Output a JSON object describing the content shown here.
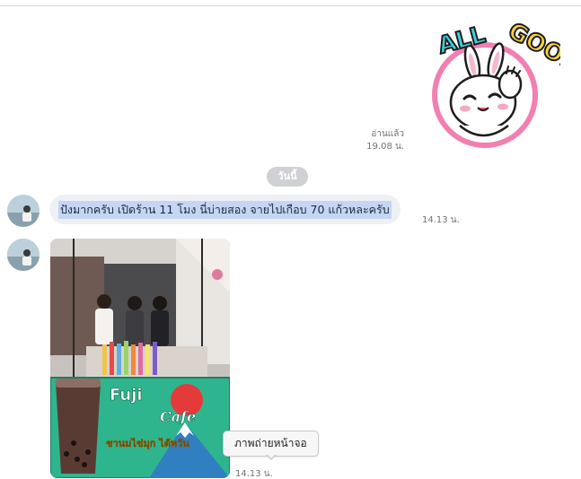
{
  "chat": {
    "sticker": {
      "text": "ALL GOOD!",
      "icon": "bunny-sticker-icon"
    },
    "outgoing_meta": {
      "read_label": "อ่านแล้ว",
      "time": "19.08 น."
    },
    "date_separator": "วันนี้",
    "messages": [
      {
        "text": "ปังมากครับ เปิดร้าน 11 โมง นี่บ่ายสอง จายไปเกือบ 70 แก้วหละครับ",
        "time": "14.13 น."
      },
      {
        "photo": {
          "sign_brand": "Fuji",
          "sign_brand_2": "Cafe",
          "sign_subtitle": "ชานมไข่มุก ไต้หวัน"
        },
        "time": "14.13 น."
      }
    ],
    "tooltip": "ภาพถ่ายหน้าจอ"
  },
  "colors": {
    "bubble_bg": "#eef0f3",
    "selection_highlight": "#c4d6f3",
    "date_pill": "#cfd1d4",
    "meta_text": "#6d7178"
  }
}
